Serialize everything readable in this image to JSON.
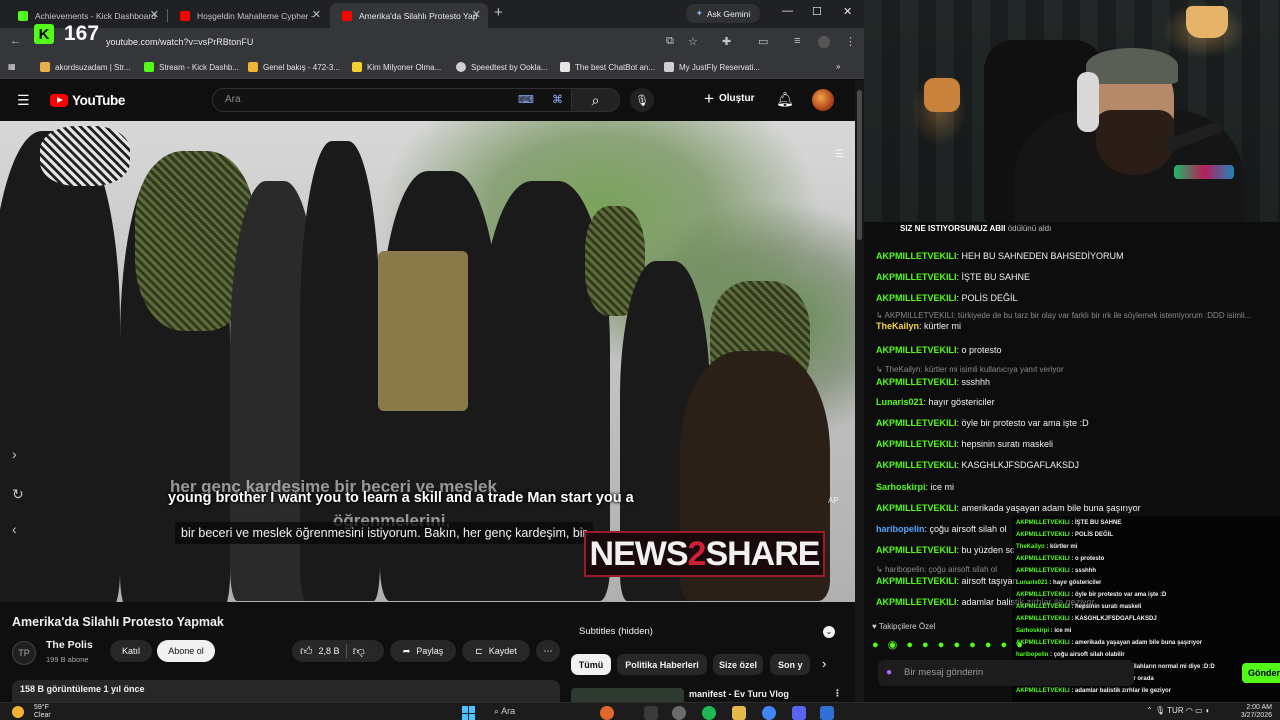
{
  "browser": {
    "tabs": [
      {
        "title": "Achievements - Kick Dashboard",
        "color": "#53fc18"
      },
      {
        "title": "Hoşgeldin Mahalleme Cypher -",
        "color": "#ff0000"
      },
      {
        "title": "Amerika'da Silahlı Protesto Yap",
        "color": "#ff0000"
      }
    ],
    "ask_gemini": "Ask Gemini",
    "kick_counter": "167",
    "url": "youtube.com/watch?v=vsPrRBtonFU",
    "bookmarks": [
      {
        "label": "akordsuzadam | Str...",
        "color": "#e8b04a"
      },
      {
        "label": "Stream - Kick Dashb...",
        "color": "#53fc18"
      },
      {
        "label": "Genel bakış - 472-3...",
        "color": "#f2b233"
      },
      {
        "label": "Kim Milyoner Olma...",
        "color": "#f2d233"
      },
      {
        "label": "Speedtest by Ookla...",
        "color": "#cfcfcf"
      },
      {
        "label": "The best ChatBot an...",
        "color": "#e5e5e5"
      },
      {
        "label": "My JustFly Reservati...",
        "color": "#cfcfcf"
      }
    ]
  },
  "youtube": {
    "logo": "YouTube",
    "search_placeholder": "Ara",
    "create_label": "Oluştur",
    "subtitle_en": "young brother I want you to learn a skill and a trade Man start you a",
    "subtitle_ghost_top": "her genç kardeşime bir beceri ve meslek",
    "subtitle_ghost_bottom": "öğrenmelerini,",
    "subtitle_tr": "bir beceri ve meslek öğrenmesini istiyorum. Bakın, her genç kardeşim, bir",
    "watermark": {
      "left": "NEWS",
      "mid": "2",
      "right": "SHARE"
    },
    "video_title": "Amerika'da Silahlı Protesto Yapmak",
    "channel": {
      "name": "The Polis",
      "subs": "199 B abone",
      "avatar": "TP"
    },
    "join_label": "Katıl",
    "subscribe_label": "Abone ol",
    "likes": "2,8 B",
    "share_label": "Paylaş",
    "save_label": "Kaydet",
    "views": "158 B görüntüleme  1 yıl önce",
    "subtitles_panel": "Subtitles (hidden)",
    "chips": [
      "Tümü",
      "Politika Haberleri",
      "Size özel",
      "Son y"
    ],
    "next_video": "manifest - Ev Turu Vlog"
  },
  "stream": {
    "redeem": {
      "user": "SIZ NE ISTIYORSUNUZ ABII",
      "text": "ödülünü aldı"
    },
    "chat": [
      {
        "user": "AKPMILLETVEKILI",
        "color": "#53fc18",
        "text": "HEH BU SAHNEDEN BAHSEDİYORUM"
      },
      {
        "user": "AKPMILLETVEKILI",
        "color": "#53fc18",
        "text": "İŞTE BU SAHNE"
      },
      {
        "user": "AKPMILLETVEKILI",
        "color": "#53fc18",
        "text": "POLİS DEĞİL"
      },
      {
        "reply": true,
        "user": "AKPMILLETVEKILI",
        "text": "türkiyede de bu tarz bir olay var farklı bir ırk ile söylemek istemiyorum :DDD isimli..."
      },
      {
        "user": "TheKailyn",
        "color": "#f5d547",
        "text": "kürtler mi"
      },
      {
        "user": "AKPMILLETVEKILI",
        "color": "#53fc18",
        "text": "o protesto"
      },
      {
        "reply": true,
        "user": "TheKailyn",
        "text": "kürtler mi isimli kullanıcıya yanıt veriyor"
      },
      {
        "user": "AKPMILLETVEKILI",
        "color": "#53fc18",
        "text": "ssshhh"
      },
      {
        "user": "Lunaris021",
        "color": "#53fc18",
        "text": "hayır göstericiler"
      },
      {
        "user": "AKPMILLETVEKILI",
        "color": "#53fc18",
        "text": "öyle bir protesto var ama işte :D"
      },
      {
        "user": "AKPMILLETVEKILI",
        "color": "#53fc18",
        "text": "hepsinin suratı maskeli"
      },
      {
        "user": "AKPMILLETVEKILI",
        "color": "#53fc18",
        "text": "KASGHLKJFSDGAFLAKSDJ"
      },
      {
        "user": "Sarhoskirpi",
        "color": "#53fc18",
        "text": "ice mi"
      },
      {
        "user": "AKPMILLETVEKILI",
        "color": "#53fc18",
        "text": "amerikada yaşayan adam bile buna şaşırıyor"
      },
      {
        "user": "haribopelin",
        "color": "#4fa7ff",
        "text": "çoğu airsoft silah ol"
      },
      {
        "user": "AKPMILLETVEKILI",
        "color": "#53fc18",
        "text": "bu yüzden sc"
      },
      {
        "reply": true,
        "user": "haribopelin",
        "text": "çoğu airsoft silah ol"
      },
      {
        "user": "AKPMILLETVEKILI",
        "color": "#53fc18",
        "text": "airsoft taşıyan"
      },
      {
        "user": "AKPMILLETVEKILI",
        "color": "#53fc18",
        "text": "adamlar balistik zırhlar ile geziyor"
      }
    ],
    "overlay_chat": [
      {
        "user": "AKPMILLETVEKILI",
        "text": "İŞTE BU SAHNE"
      },
      {
        "user": "AKPMILLETVEKILI",
        "text": "POLİS DEĞİL"
      },
      {
        "user": "TheKailyn",
        "text": "kürtler mi"
      },
      {
        "user": "AKPMILLETVEKILI",
        "text": "o protesto"
      },
      {
        "user": "AKPMILLETVEKILI",
        "text": "ssshhh"
      },
      {
        "user": "Lunaris021",
        "text": "hayır göstericiler"
      },
      {
        "user": "AKPMILLETVEKILI",
        "text": "öyle bir protesto var ama işte :D"
      },
      {
        "user": "AKPMILLETVEKILI",
        "text": "hepsinin suratı maskeli"
      },
      {
        "user": "AKPMILLETVEKILI",
        "text": "KASGHLKJFSDGAFLAKSDJ"
      },
      {
        "user": "Sarhoskirpi",
        "text": "ice mi"
      },
      {
        "user": "AKPMILLETVEKILI",
        "text": "amerikada yaşayan adam bile buna şaşırıyor"
      },
      {
        "user": "haribopelin",
        "text": "çoğu airsoft silah olabilir"
      },
      {
        "user": "AKPMILLETVEKILI",
        "text": "bu yüzden sordum silahların normal mi diye :D:D"
      },
      {
        "user": "AKPMILLETVEKILI",
        "text": "airsoft taşıyan yoktur orada"
      },
      {
        "user": "AKPMILLETVEKILI",
        "text": "adamlar balistik zırhlar ile geziyor"
      }
    ],
    "pinned_label": "Takipçilere Özel",
    "emotes": "● ◉ ● ● ● ● ● ● ● ●",
    "chat_placeholder": "Bir mesaj gönderin",
    "send_label": "Gönder"
  },
  "taskbar": {
    "temp": "59°F",
    "condition": "Clear",
    "search": "Ara",
    "lang": "TUR",
    "time": "2:00 AM",
    "date": "3/27/2026"
  },
  "colors": {
    "kick_green": "#53fc18",
    "yt_red": "#ff0000",
    "bg": "#0f0f0f"
  }
}
